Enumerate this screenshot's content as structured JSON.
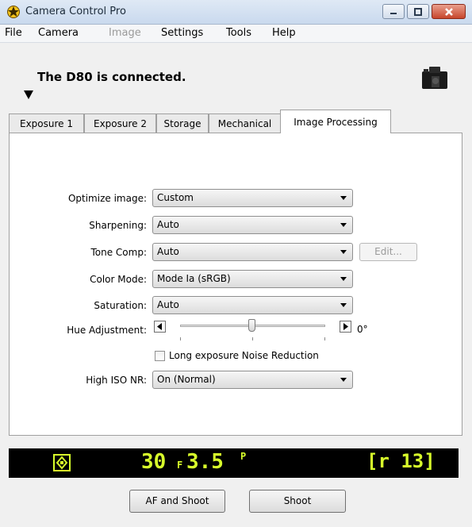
{
  "window": {
    "title": "Camera Control Pro"
  },
  "menu": [
    {
      "label": "File",
      "enabled": true
    },
    {
      "label": "Camera",
      "enabled": true
    },
    {
      "label": "Image",
      "enabled": false
    },
    {
      "label": "Settings",
      "enabled": true
    },
    {
      "label": "Tools",
      "enabled": true
    },
    {
      "label": "Help",
      "enabled": true
    }
  ],
  "header": {
    "status": "The D80 is connected."
  },
  "tabs": [
    {
      "label": "Exposure 1",
      "active": false
    },
    {
      "label": "Exposure 2",
      "active": false
    },
    {
      "label": "Storage",
      "active": false
    },
    {
      "label": "Mechanical",
      "active": false
    },
    {
      "label": "Image Processing",
      "active": true
    }
  ],
  "form": {
    "optimize": {
      "label": "Optimize image:",
      "value": "Custom"
    },
    "sharpening": {
      "label": "Sharpening:",
      "value": "Auto"
    },
    "tone": {
      "label": "Tone Comp:",
      "value": "Auto",
      "edit_label": "Edit..."
    },
    "color_mode": {
      "label": "Color Mode:",
      "value": "Mode Ia (sRGB)"
    },
    "saturation": {
      "label": "Saturation:",
      "value": "Auto"
    },
    "hue": {
      "label": "Hue Adjustment:",
      "value": "0°",
      "level": 0.5
    },
    "long_exposure": {
      "label": "Long exposure Noise Reduction",
      "checked": false
    },
    "high_iso": {
      "label": "High ISO NR:",
      "value": "On (Normal)"
    }
  },
  "lcd": {
    "shutter": "30",
    "aperture_prefix": "F",
    "aperture": "3.5",
    "mode": "P",
    "remaining": "[r 13]"
  },
  "buttons": {
    "af_shoot": "AF and Shoot",
    "shoot": "Shoot"
  },
  "colors": {
    "lcd_text": "#d8ff2b",
    "lcd_bg": "#000000"
  }
}
